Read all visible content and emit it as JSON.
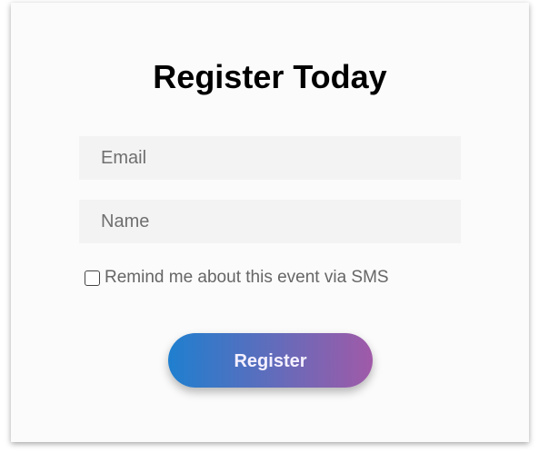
{
  "form": {
    "title": "Register Today",
    "email_placeholder": "Email",
    "email_value": "",
    "name_placeholder": "Name",
    "name_value": "",
    "sms_reminder_label": "Remind me about this event via SMS",
    "sms_reminder_checked": false,
    "submit_label": "Register"
  },
  "colors": {
    "card_background": "#fbfbfb",
    "field_background": "#f3f3f3",
    "button_gradient_start": "#1f7fcf",
    "button_gradient_end": "#a05aa8",
    "title_color": "#000000",
    "label_color": "#666666"
  }
}
